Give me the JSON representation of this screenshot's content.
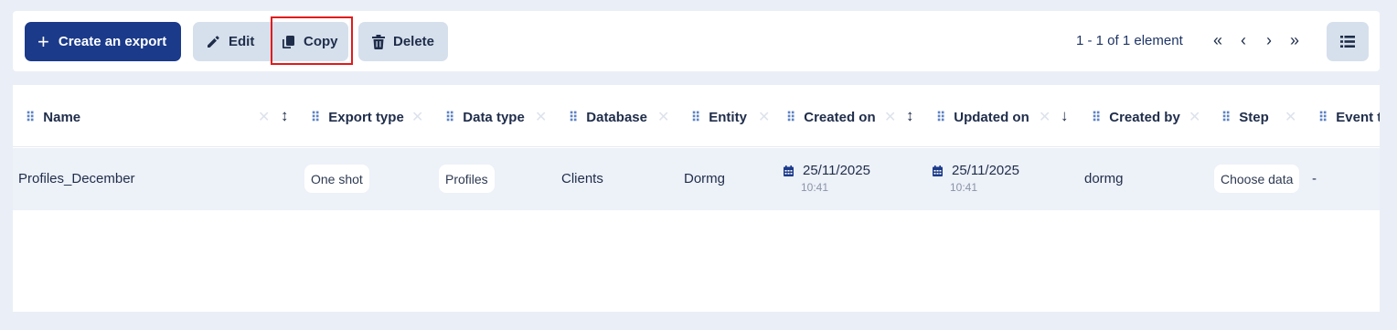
{
  "toolbar": {
    "create_label": "Create an export",
    "edit_label": "Edit",
    "copy_label": "Copy",
    "delete_label": "Delete",
    "pagination_text": "1 - 1 of 1 element",
    "first_icon": "«",
    "prev_icon": "‹",
    "next_icon": "›",
    "last_icon": "»"
  },
  "table": {
    "columns": [
      {
        "label": "Name"
      },
      {
        "label": "Export type"
      },
      {
        "label": "Data type"
      },
      {
        "label": "Database"
      },
      {
        "label": "Entity"
      },
      {
        "label": "Created on"
      },
      {
        "label": "Updated on"
      },
      {
        "label": "Created by"
      },
      {
        "label": "Step"
      },
      {
        "label": "Event t"
      }
    ],
    "rows": [
      {
        "name": "Profiles_December",
        "export_type": "One shot",
        "data_type": "Profiles",
        "database": "Clients",
        "entity": "Dormg",
        "created_on_date": "25/11/2025",
        "created_on_time": "10:41",
        "updated_on_date": "25/11/2025",
        "updated_on_time": "10:41",
        "created_by": "dormg",
        "step": "Choose data",
        "event": "-"
      }
    ]
  },
  "colors": {
    "primary": "#1b3a8a",
    "secondary_button": "#d6e0ec",
    "highlight_box": "#e01b1b",
    "row_background": "#edf1f8"
  }
}
